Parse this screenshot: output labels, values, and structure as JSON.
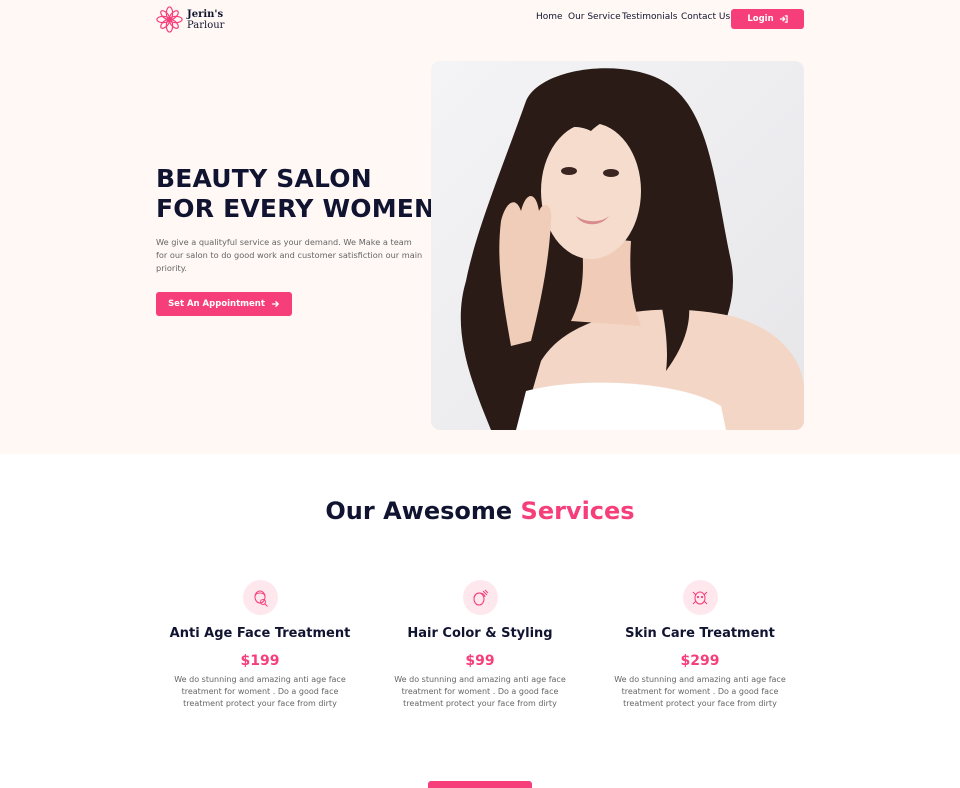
{
  "brand": {
    "line1": "Jerin's",
    "line2": "Parlour"
  },
  "nav": {
    "items": [
      "Home",
      "Our Service",
      "Testimonials",
      "Contact Us"
    ],
    "login_label": "Login"
  },
  "hero": {
    "title_line1": "BEAUTY SALON",
    "title_line2": "FOR EVERY WOMEN",
    "description": "We give a qualityful service as your demand. We Make a team for our salon to do good work and customer satisfiction our main priority.",
    "cta_label": "Set An Appointment"
  },
  "services": {
    "heading_dark": "Our Awesome",
    "heading_accent": "Services",
    "items": [
      {
        "icon": "face-treatment-icon",
        "title": "Anti Age Face Treatment",
        "price": "$199",
        "description": "We do stunning and amazing anti age face treatment for woment . Do a good face treatment protect your face from dirty"
      },
      {
        "icon": "hair-styling-icon",
        "title": "Hair Color & Styling",
        "price": "$99",
        "description": "We do stunning and amazing anti age face treatment for woment . Do a good face treatment protect your face from dirty"
      },
      {
        "icon": "skin-care-icon",
        "title": "Skin Care Treatment",
        "price": "$299",
        "description": "We do stunning and amazing anti age face treatment for woment . Do a good face treatment protect your face from dirty"
      }
    ]
  },
  "colors": {
    "accent": "#F63E7B",
    "dark": "#111430",
    "hero_bg": "#FFF8F5",
    "icon_bg": "#FFE7EE"
  }
}
